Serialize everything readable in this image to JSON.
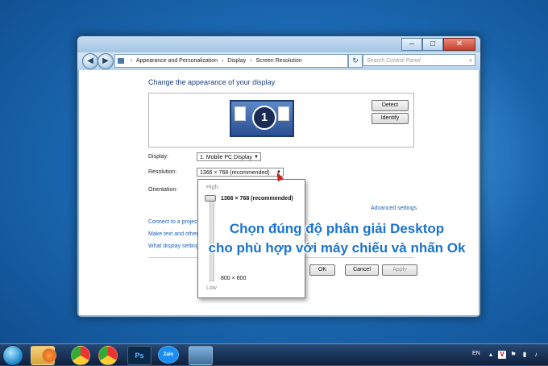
{
  "window": {
    "breadcrumb": [
      "Appearance and Personalization",
      "Display",
      "Screen Resolution"
    ],
    "search_placeholder": "Search Control Panel",
    "nav_back": "◀",
    "nav_forward": "▶",
    "refresh_icon": "↻"
  },
  "main": {
    "heading": "Change the appearance of your display",
    "monitor_number": "1",
    "detect_button": "Detect",
    "identify_button": "Identify",
    "display_label": "Display:",
    "display_value": "1. Mobile PC Display",
    "resolution_label": "Resolution:",
    "resolution_value": "1366 × 768 (recommended)",
    "orientation_label": "Orientation:",
    "advanced_settings": "Advanced settings",
    "link_projector": "Connect to a projector",
    "link_text_size": "Make text and other items larger or smaller",
    "link_display_settings": "What display settings should I choose?",
    "ok_button": "OK",
    "cancel_button": "Cancel",
    "apply_button": "Apply"
  },
  "resolution_popup": {
    "high_label": "High",
    "low_label": "Low",
    "option_recommended": "1366 × 768 (recommended)",
    "option_low": "800 × 600"
  },
  "overlay_text": {
    "line1": "Chọn đúng độ phân giải Desktop",
    "line2": "cho phù hợp với máy chiếu và nhấn Ok"
  },
  "taskbar": {
    "icons": [
      "folder-icon",
      "media-player-icon",
      "chrome-icon",
      "chrome-icon",
      "photoshop-icon",
      "zalo-icon",
      "control-panel-icon"
    ],
    "ps_label": "Ps",
    "zalo_label": "Zalo",
    "language": "EN"
  }
}
